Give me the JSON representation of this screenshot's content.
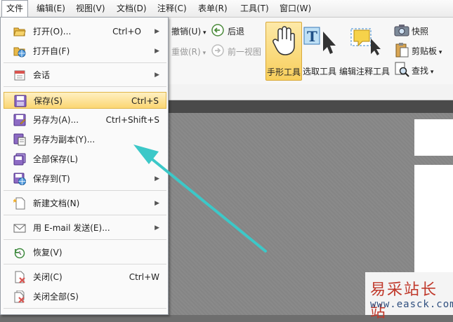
{
  "menubar": {
    "items": [
      "文件",
      "编辑(E)",
      "视图(V)",
      "文档(D)",
      "注释(C)",
      "表单(R)",
      "工具(T)",
      "窗口(W)"
    ]
  },
  "ribbon": {
    "undo": "撤销(U)",
    "back": "后退",
    "redo": "重做(R)",
    "prev_view": "前一视图",
    "hand_tool": "手形工具",
    "select_tool": "选取工具",
    "edit_annot_tool": "编辑注释工具",
    "snapshot": "快照",
    "clipboard": "剪贴板",
    "find": "查找"
  },
  "file_menu": {
    "items": [
      {
        "label": "打开(O)...",
        "shortcut": "Ctrl+O",
        "submenu": true
      },
      {
        "label": "打开自(F)",
        "shortcut": "",
        "submenu": true
      },
      {
        "label": "会话",
        "shortcut": "",
        "submenu": true
      },
      {
        "label": "保存(S)",
        "shortcut": "Ctrl+S",
        "submenu": false
      },
      {
        "label": "另存为(A)...",
        "shortcut": "Ctrl+Shift+S",
        "submenu": false
      },
      {
        "label": "另存为副本(Y)...",
        "shortcut": "",
        "submenu": false
      },
      {
        "label": "全部保存(L)",
        "shortcut": "",
        "submenu": false
      },
      {
        "label": "保存到(T)",
        "shortcut": "",
        "submenu": true
      },
      {
        "label": "新建文档(N)",
        "shortcut": "",
        "submenu": true
      },
      {
        "label": "用 E-mail 发送(E)...",
        "shortcut": "",
        "submenu": true
      },
      {
        "label": "恢复(V)",
        "shortcut": "",
        "submenu": false
      },
      {
        "label": "关闭(C)",
        "shortcut": "Ctrl+W",
        "submenu": false
      },
      {
        "label": "关闭全部(S)",
        "shortcut": "",
        "submenu": false
      }
    ]
  },
  "watermark": {
    "line1": "易采站长站",
    "line2": "www.easck.com"
  },
  "colors": {
    "highlight": "#fbd673",
    "arrow": "#3cc8c8",
    "watermark_red": "#c0392b"
  }
}
